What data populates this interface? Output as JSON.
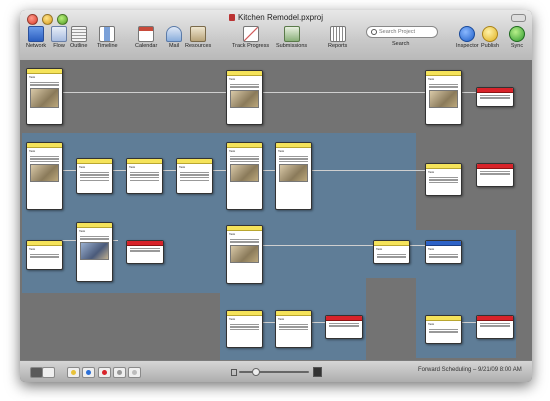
{
  "window": {
    "title": "Kitchen Remodel.pxproj"
  },
  "toolbar": {
    "items": [
      {
        "label": "Network",
        "icon": "network-icon",
        "color": "#3a6fd0"
      },
      {
        "label": "Flow",
        "icon": "flow-icon",
        "color": "#6a8fd0"
      },
      {
        "label": "Outline",
        "icon": "outline-icon",
        "color": "#8a8a8a"
      },
      {
        "label": "Timeline",
        "icon": "timeline-icon",
        "color": "#7aa0d8"
      },
      {
        "label": "Calendar",
        "icon": "calendar-icon",
        "color": "#c84a3a"
      },
      {
        "label": "Mail",
        "icon": "mail-icon",
        "color": "#5a8ad0"
      },
      {
        "label": "Resources",
        "icon": "resources-icon",
        "color": "#8a7a5a"
      },
      {
        "label": "Track Progress",
        "icon": "track-progress-icon",
        "color": "#c83a3a"
      },
      {
        "label": "Submissions",
        "icon": "submissions-icon",
        "color": "#5a8a5a"
      },
      {
        "label": "Reports",
        "icon": "reports-icon",
        "color": "#8a8a8a"
      },
      {
        "label": "Inspector",
        "icon": "inspector-icon",
        "color": "#2b6fd8"
      },
      {
        "label": "Publish",
        "icon": "publish-icon",
        "color": "#e8c23a"
      },
      {
        "label": "Sync",
        "icon": "sync-icon",
        "color": "#3aa83a"
      }
    ],
    "search": {
      "placeholder": "Search Project",
      "label": "Search"
    }
  },
  "statusbar": {
    "schedule_text": "Forward Scheduling – 9/21/09 8:00 AM"
  },
  "colors": {
    "canvas": "#737373",
    "band": "#5f7d97",
    "task_header": "#f5e35a",
    "milestone_header": "#d8232a",
    "selected_header": "#2e63c7"
  }
}
